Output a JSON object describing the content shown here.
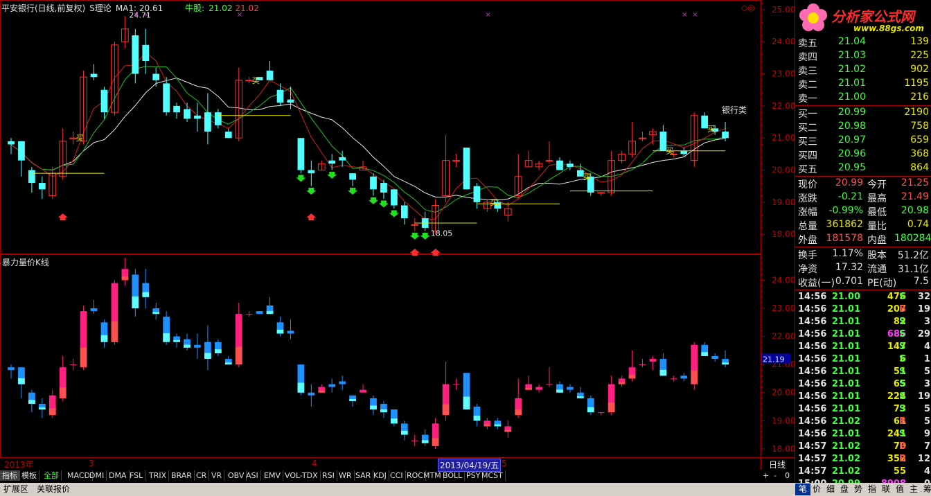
{
  "header": {
    "title": "平安银行(日线,前复权)",
    "theory": "S理论",
    "ma1": "MA1: 20.61",
    "bull_label": "牛股:",
    "bull_v1": "21.02",
    "bull_v2": "21.02"
  },
  "sub_header": {
    "title": "暴力量价K线"
  },
  "industry_label": "银行类",
  "right_panel": {
    "logo_title": "分析家公式网",
    "logo_url": "www.88gs.com",
    "sell_orders": [
      {
        "label": "卖五",
        "price": "21.04",
        "vol": "139"
      },
      {
        "label": "卖四",
        "price": "21.03",
        "vol": "225"
      },
      {
        "label": "卖三",
        "price": "21.02",
        "vol": "902"
      },
      {
        "label": "卖二",
        "price": "21.01",
        "vol": "1195"
      },
      {
        "label": "卖一",
        "price": "21.00",
        "vol": "216"
      }
    ],
    "buy_orders": [
      {
        "label": "买一",
        "price": "20.99",
        "vol": "2190"
      },
      {
        "label": "买二",
        "price": "20.98",
        "vol": "758"
      },
      {
        "label": "买三",
        "price": "20.97",
        "vol": "659"
      },
      {
        "label": "买四",
        "price": "20.96",
        "vol": "368"
      },
      {
        "label": "买五",
        "price": "20.95",
        "vol": "864"
      }
    ],
    "quote": [
      {
        "l1": "现价",
        "v1": "20.99",
        "c1": "#ff5050",
        "l2": "今开",
        "v2": "21.25",
        "c2": "#ff5050"
      },
      {
        "l1": "涨跌",
        "v1": "-0.21",
        "c1": "#40ff40",
        "l2": "最高",
        "v2": "21.49",
        "c2": "#ff5050"
      },
      {
        "l1": "涨幅",
        "v1": "-0.99%",
        "c1": "#40ff40",
        "l2": "最低",
        "v2": "20.98",
        "c2": "#40ff40"
      },
      {
        "l1": "总量",
        "v1": "361862",
        "c1": "#e8e800",
        "l2": "量比",
        "v2": "0.74",
        "c2": "#e8e800"
      },
      {
        "l1": "外盘",
        "v1": "181578",
        "c1": "#ff5050",
        "l2": "内盘",
        "v2": "180284",
        "c2": "#40ff40"
      }
    ],
    "fundamentals": [
      {
        "l1": "换手",
        "v1": "1.17%",
        "l2": "股本",
        "v2": "51.2亿"
      },
      {
        "l1": "净资",
        "v1": "17.32",
        "l2": "流通",
        "v2": "31.1亿"
      },
      {
        "l1": "收益(一)",
        "v1": "0.701",
        "l2": "PE(动)",
        "v2": "7.5"
      }
    ],
    "ticks": [
      {
        "t": "14:56",
        "p": "21.00",
        "pc": "#40ff40",
        "v": "476",
        "vc": "#e8e800",
        "bs": "S",
        "n": "32"
      },
      {
        "t": "14:56",
        "p": "21.01",
        "pc": "#40ff40",
        "v": "207",
        "vc": "#e8e800",
        "bs": "B",
        "n": "19"
      },
      {
        "t": "14:56",
        "p": "21.01",
        "pc": "#40ff40",
        "v": "82",
        "vc": "#e8e800",
        "bs": "S",
        "n": "3"
      },
      {
        "t": "14:56",
        "p": "21.01",
        "pc": "#40ff40",
        "v": "686",
        "vc": "#ff40ff",
        "bs": "S",
        "n": "29"
      },
      {
        "t": "14:56",
        "p": "21.01",
        "pc": "#40ff40",
        "v": "147",
        "vc": "#e8e800",
        "bs": "S",
        "n": "4"
      },
      {
        "t": "14:56",
        "p": "21.01",
        "pc": "#40ff40",
        "v": "6",
        "vc": "#e8e800",
        "bs": "S",
        "n": "1"
      },
      {
        "t": "14:56",
        "p": "21.01",
        "pc": "#40ff40",
        "v": "51",
        "vc": "#e8e800",
        "bs": "S",
        "n": "5"
      },
      {
        "t": "14:56",
        "p": "21.01",
        "pc": "#40ff40",
        "v": "65",
        "vc": "#e8e800",
        "bs": "S",
        "n": "3"
      },
      {
        "t": "14:56",
        "p": "21.01",
        "pc": "#40ff40",
        "v": "224",
        "vc": "#e8e800",
        "bs": "S",
        "n": "19"
      },
      {
        "t": "14:56",
        "p": "21.01",
        "pc": "#40ff40",
        "v": "73",
        "vc": "#e8e800",
        "bs": "S",
        "n": "5"
      },
      {
        "t": "14:56",
        "p": "21.02",
        "pc": "#40ff40",
        "v": "61",
        "vc": "#e8e800",
        "bs": "B",
        "n": "5"
      },
      {
        "t": "14:56",
        "p": "21.01",
        "pc": "#40ff40",
        "v": "241",
        "vc": "#e8e800",
        "bs": "S",
        "n": "9"
      },
      {
        "t": "14:57",
        "p": "21.02",
        "pc": "#40ff40",
        "v": "70",
        "vc": "#e8e800",
        "bs": "B",
        "n": "7"
      },
      {
        "t": "14:57",
        "p": "21.02",
        "pc": "#40ff40",
        "v": "352",
        "vc": "#e8e800",
        "bs": "B",
        "n": "12"
      },
      {
        "t": "14:57",
        "p": "21.02",
        "pc": "#40ff40",
        "v": "55",
        "vc": "#e8e800",
        "bs": "",
        "n": "4"
      },
      {
        "t": "15:00",
        "p": "20.99",
        "pc": "#40ff40",
        "v": "8908",
        "vc": "#ff40ff",
        "bs": "",
        "n": "0"
      }
    ]
  },
  "xaxis": {
    "labels": [
      "2013年",
      "3",
      "4",
      "5"
    ],
    "cursor_date": "2013/04/19/五",
    "period": "日线"
  },
  "zoom_controls": [
    "+",
    "-",
    "0"
  ],
  "tabs": [
    "指标",
    "模板",
    "全部",
    "MACD",
    "DMI",
    "DMA",
    "FSL",
    "TRIX",
    "BRAR",
    "CR",
    "VR",
    "OBV",
    "ASI",
    "EMV",
    "VOL-TDX",
    "RSI",
    "WR",
    "SAR",
    "KDJ",
    "CCI",
    "ROC",
    "MTM",
    "BOLL",
    "PSY",
    "MCST"
  ],
  "bottom_tabs": [
    "扩展区",
    "关联报价"
  ],
  "bottom_right_tabs": [
    "笔",
    "价",
    "细",
    "盘",
    "势",
    "指",
    "联",
    "值",
    "主",
    "筹"
  ],
  "chart_data": [
    {
      "type": "candlestick",
      "title": "平安银行(日线,前复权)",
      "ylim": [
        17.4,
        25.3
      ],
      "yticks": [
        18.0,
        19.0,
        20.0,
        21.0,
        22.0,
        23.0,
        24.0,
        25.0
      ],
      "candles": [
        [
          20.9,
          21.0,
          20.5,
          20.8
        ],
        [
          20.9,
          20.9,
          19.8,
          20.3
        ],
        [
          20.0,
          20.1,
          19.3,
          19.6
        ],
        [
          19.6,
          19.8,
          19.1,
          19.4
        ],
        [
          19.2,
          20.1,
          19.1,
          19.9
        ],
        [
          19.8,
          21.3,
          19.7,
          20.9
        ],
        [
          21.0,
          21.2,
          20.8,
          21.0
        ],
        [
          20.9,
          23.1,
          20.8,
          22.9
        ],
        [
          23.0,
          23.3,
          22.8,
          22.9
        ],
        [
          22.5,
          22.6,
          21.6,
          21.8
        ],
        [
          21.8,
          24.0,
          21.7,
          23.9
        ],
        [
          24.0,
          24.8,
          23.8,
          24.4
        ],
        [
          24.2,
          24.4,
          22.7,
          23.0
        ],
        [
          23.9,
          24.4,
          23.0,
          23.4
        ],
        [
          23.0,
          23.2,
          22.6,
          22.8
        ],
        [
          22.7,
          22.9,
          21.7,
          21.8
        ],
        [
          22.0,
          22.1,
          21.6,
          21.8
        ],
        [
          21.9,
          22.1,
          21.5,
          21.6
        ],
        [
          21.7,
          22.1,
          21.2,
          21.6
        ],
        [
          21.8,
          22.4,
          20.8,
          21.2
        ],
        [
          21.8,
          21.9,
          21.3,
          21.4
        ],
        [
          21.2,
          21.3,
          21.0,
          21.0
        ],
        [
          21.0,
          23.2,
          20.9,
          22.8
        ],
        [
          22.8,
          22.9,
          22.7,
          22.8
        ],
        [
          22.9,
          22.9,
          22.8,
          22.8
        ],
        [
          23.1,
          23.4,
          22.8,
          22.8
        ],
        [
          22.5,
          22.7,
          22.0,
          22.1
        ],
        [
          22.2,
          22.6,
          21.9,
          22.1
        ],
        [
          21.0,
          21.0,
          19.9,
          20.0
        ],
        [
          20.0,
          20.3,
          19.5,
          19.9
        ],
        [
          20.0,
          20.3,
          20.0,
          20.2
        ],
        [
          20.3,
          20.5,
          20.0,
          20.2
        ],
        [
          20.4,
          20.6,
          20.1,
          20.3
        ],
        [
          19.9,
          19.9,
          19.5,
          19.7
        ],
        [
          20.0,
          20.3,
          20.0,
          20.1
        ],
        [
          19.8,
          19.9,
          19.2,
          19.4
        ],
        [
          19.6,
          19.7,
          19.1,
          19.3
        ],
        [
          19.4,
          19.4,
          18.8,
          18.9
        ],
        [
          18.9,
          19.0,
          18.3,
          18.5
        ],
        [
          18.3,
          18.5,
          18.1,
          18.3
        ],
        [
          18.5,
          18.7,
          18.1,
          18.2
        ],
        [
          18.1,
          19.1,
          18.0,
          18.9
        ],
        [
          19.2,
          21.1,
          19.0,
          20.3
        ],
        [
          20.3,
          20.5,
          20.1,
          20.3
        ],
        [
          20.7,
          20.7,
          19.4,
          19.4
        ],
        [
          19.5,
          19.6,
          18.8,
          19.0
        ],
        [
          18.8,
          19.1,
          18.7,
          19.0
        ],
        [
          19.0,
          19.1,
          18.7,
          18.8
        ],
        [
          18.6,
          19.0,
          18.4,
          18.8
        ],
        [
          19.2,
          20.5,
          19.1,
          19.8
        ],
        [
          20.1,
          20.6,
          20.1,
          20.3
        ],
        [
          20.1,
          20.3,
          20.0,
          20.2
        ],
        [
          20.3,
          20.9,
          20.2,
          20.3
        ],
        [
          20.3,
          20.4,
          20.0,
          20.0
        ],
        [
          20.2,
          20.3,
          20.0,
          20.1
        ],
        [
          20.0,
          20.2,
          19.8,
          19.8
        ],
        [
          19.8,
          19.9,
          19.2,
          19.3
        ],
        [
          19.3,
          19.3,
          19.2,
          19.3
        ],
        [
          19.3,
          20.6,
          19.2,
          20.3
        ],
        [
          20.3,
          20.6,
          20.2,
          20.5
        ],
        [
          20.5,
          21.5,
          20.4,
          20.9
        ],
        [
          21.0,
          21.2,
          20.9,
          21.0
        ],
        [
          21.1,
          21.3,
          20.8,
          21.2
        ],
        [
          21.2,
          21.4,
          20.6,
          20.6
        ],
        [
          20.5,
          20.6,
          20.4,
          20.5
        ],
        [
          20.6,
          20.7,
          20.4,
          20.5
        ],
        [
          20.3,
          21.8,
          20.1,
          21.7
        ],
        [
          21.7,
          21.8,
          21.4,
          21.3
        ],
        [
          21.3,
          21.4,
          21.1,
          21.2
        ],
        [
          21.2,
          21.5,
          20.9,
          21.0
        ]
      ],
      "annotations": {
        "high_label": "24.71",
        "low_label": "18.05",
        "buy_label": "买"
      }
    },
    {
      "type": "candlestick",
      "title": "暴力量价K线",
      "ylim": [
        17.7,
        24.9
      ],
      "yticks": [
        18.0,
        19.0,
        20.0,
        21.0,
        22.0,
        23.0,
        24.0
      ],
      "last_price_label": "21.19"
    }
  ]
}
